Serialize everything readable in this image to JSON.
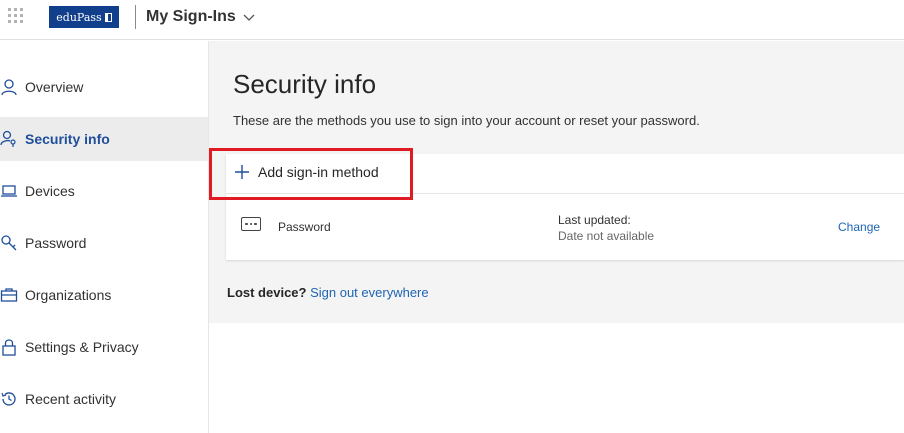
{
  "header": {
    "logo_text": "eduPass",
    "app_title": "My Sign-Ins"
  },
  "sidebar": {
    "items": [
      {
        "label": "Overview",
        "icon": "person-icon"
      },
      {
        "label": "Security info",
        "icon": "key-person-icon",
        "active": true
      },
      {
        "label": "Devices",
        "icon": "laptop-icon"
      },
      {
        "label": "Password",
        "icon": "key-icon"
      },
      {
        "label": "Organizations",
        "icon": "briefcase-icon"
      },
      {
        "label": "Settings & Privacy",
        "icon": "lock-icon"
      },
      {
        "label": "Recent activity",
        "icon": "history-icon"
      }
    ]
  },
  "main": {
    "title": "Security info",
    "subtitle": "These are the methods you use to sign into your account or reset your password.",
    "add_method_label": "Add sign-in method",
    "methods": [
      {
        "name": "Password",
        "icon": "password-dots-icon",
        "updated_label": "Last updated:",
        "updated_value": "Date not available",
        "action_label": "Change"
      }
    ],
    "lost_device_label": "Lost device?",
    "sign_out_link": "Sign out everywhere"
  },
  "colors": {
    "brand": "#123f8c",
    "accent_link": "#1f64b3",
    "active_nav_text": "#1f4e9b",
    "highlight": "#e01b24"
  }
}
